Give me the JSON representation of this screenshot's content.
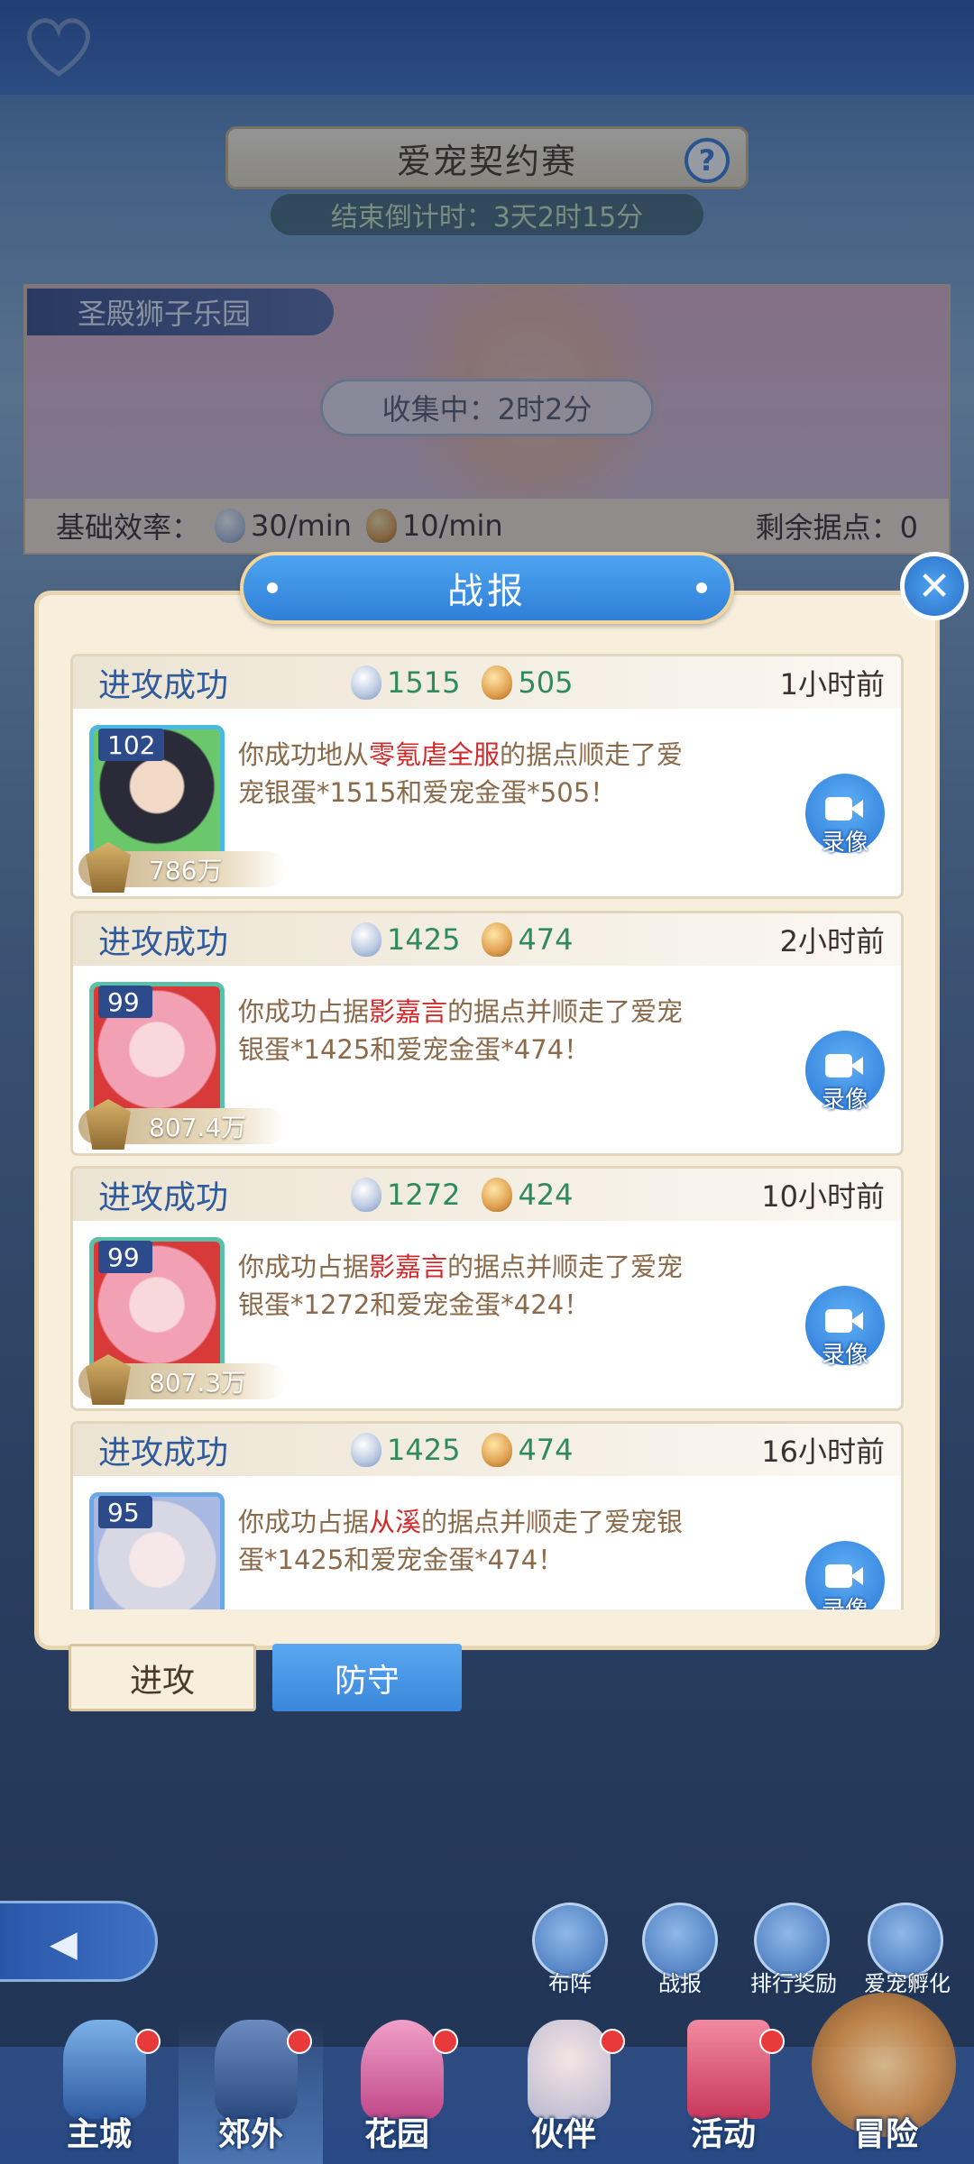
{
  "event": {
    "title": "爱宠契约赛",
    "help": "?",
    "countdown": "结束倒计时：3天2时15分"
  },
  "territory": {
    "name": "圣殿狮子乐园",
    "collecting": "收集中：2时2分",
    "efficiency_label": "基础效率：",
    "silver_rate": "30/min",
    "gold_rate": "10/min",
    "remaining": "剩余据点：0"
  },
  "modal": {
    "title": "战报",
    "close": "✕",
    "replay_label": "录像",
    "reports": [
      {
        "status": "进攻成功",
        "silver": "1515",
        "gold": "505",
        "time": "1小时前",
        "level": "102",
        "power": "786万",
        "msg_pre": "你成功地从",
        "opponent": "零氪虐全服",
        "msg_post": "的据点顺走了爱宠银蛋*1515和爱宠金蛋*505！"
      },
      {
        "status": "进攻成功",
        "silver": "1425",
        "gold": "474",
        "time": "2小时前",
        "level": "99",
        "power": "807.4万",
        "msg_pre": "你成功占据",
        "opponent": "影嘉言",
        "msg_post": "的据点并顺走了爱宠银蛋*1425和爱宠金蛋*474！"
      },
      {
        "status": "进攻成功",
        "silver": "1272",
        "gold": "424",
        "time": "10小时前",
        "level": "99",
        "power": "807.3万",
        "msg_pre": "你成功占据",
        "opponent": "影嘉言",
        "msg_post": "的据点并顺走了爱宠银蛋*1272和爱宠金蛋*424！"
      },
      {
        "status": "进攻成功",
        "silver": "1425",
        "gold": "474",
        "time": "16小时前",
        "level": "95",
        "power": "",
        "msg_pre": "你成功占据",
        "opponent": "从溪",
        "msg_post": "的据点并顺走了爱宠银蛋*1425和爱宠金蛋*474！"
      }
    ],
    "tabs": {
      "attack": "进攻",
      "defend": "防守"
    }
  },
  "side_buttons": [
    "布阵",
    "战报",
    "排行奖励",
    "爱宠孵化"
  ],
  "nav": [
    "主城",
    "郊外",
    "花园",
    "伙伴",
    "活动",
    "冒险"
  ],
  "colors": {
    "accent_blue": "#3a86dc",
    "opponent_red": "#d22a2a",
    "loot_green": "#2f8a5e"
  }
}
